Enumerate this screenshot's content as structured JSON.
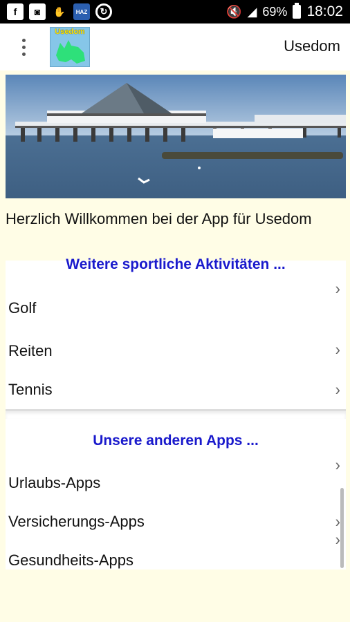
{
  "status_bar": {
    "icons": [
      "facebook-icon",
      "photo-icon",
      "hand-icon",
      "haz-news-icon",
      "sync-icon"
    ],
    "haz_label": "HAZ",
    "battery": "69%",
    "time": "18:02"
  },
  "app_bar": {
    "logo_text": "Usedom",
    "title": "Usedom"
  },
  "welcome_text": "Herzlich Willkommen bei der App für Usedom",
  "section_sports": {
    "title": "Weitere sportliche Aktivitäten ...",
    "items": [
      {
        "label": "Golf"
      },
      {
        "label": "Reiten"
      },
      {
        "label": "Tennis"
      }
    ]
  },
  "section_apps": {
    "title": "Unsere anderen Apps ...",
    "items": [
      {
        "label": "Urlaubs-Apps"
      },
      {
        "label": "Versicherungs-Apps"
      },
      {
        "label": "Gesundheits-Apps"
      }
    ]
  },
  "colors": {
    "background": "#fffde6",
    "section_title": "#1a1acc"
  }
}
